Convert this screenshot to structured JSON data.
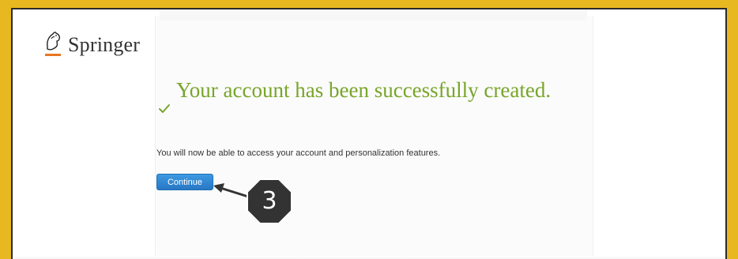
{
  "brand": {
    "name": "Springer",
    "logo_icon": "springer-horse-icon"
  },
  "confirmation": {
    "heading": "Your account has been successfully created.",
    "message": "You will now be able to access your account and personalization features.",
    "status_icon": "checkmark-icon",
    "accent_color": "#78a52a"
  },
  "actions": {
    "continue_label": "Continue",
    "button_color": "#2f84d0"
  },
  "annotation": {
    "step_number": "3",
    "badge_color": "#333333",
    "background_color": "#e8b820"
  }
}
